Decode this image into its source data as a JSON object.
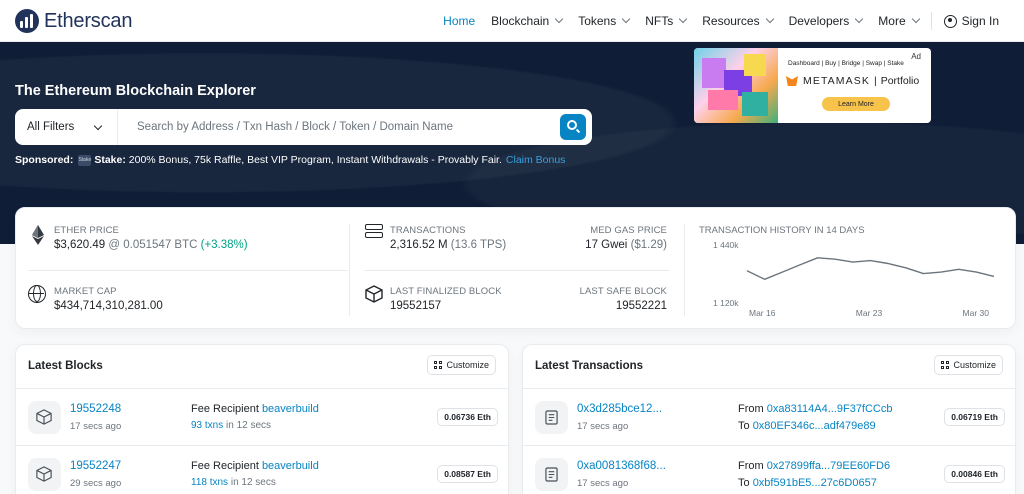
{
  "nav": {
    "brand": "Etherscan",
    "items": [
      {
        "label": "Home",
        "active": true,
        "dropdown": false
      },
      {
        "label": "Blockchain",
        "dropdown": true
      },
      {
        "label": "Tokens",
        "dropdown": true
      },
      {
        "label": "NFTs",
        "dropdown": true
      },
      {
        "label": "Resources",
        "dropdown": true
      },
      {
        "label": "Developers",
        "dropdown": true
      },
      {
        "label": "More",
        "dropdown": true
      }
    ],
    "sign_in": "Sign In"
  },
  "hero": {
    "title": "The Ethereum Blockchain Explorer",
    "filter": "All Filters",
    "search_placeholder": "Search by Address / Txn Hash / Block / Token / Domain Name",
    "sponsored_label": "Sponsored:",
    "sponsor_logo_text": "Stake",
    "sponsor_name": "Stake:",
    "sponsor_text": "200% Bonus, 75k Raffle, Best VIP Program, Instant Withdrawals - Provably Fair.",
    "sponsor_link": "Claim Bonus"
  },
  "ad": {
    "label": "Ad",
    "links": "Dashboard | Buy | Bridge | Swap | Stake",
    "brand": "METAMASK",
    "brand_sep": "|",
    "product": "Portfolio",
    "cta": "Learn More"
  },
  "stats": {
    "ether_price_label": "ETHER PRICE",
    "ether_price": "$3,620.49",
    "ether_btc": "@ 0.051547 BTC",
    "ether_change": "(+3.38%)",
    "market_cap_label": "MARKET CAP",
    "market_cap": "$434,714,310,281.00",
    "transactions_label": "TRANSACTIONS",
    "transactions": "2,316.52 M",
    "tps": "(13.6 TPS)",
    "gas_label": "MED GAS PRICE",
    "gas": "17 Gwei",
    "gas_usd": "($1.29)",
    "finalized_label": "LAST FINALIZED BLOCK",
    "finalized": "19552157",
    "safe_label": "LAST SAFE BLOCK",
    "safe": "19552221",
    "chart_title": "TRANSACTION HISTORY IN 14 DAYS"
  },
  "chart_data": {
    "type": "line",
    "title": "TRANSACTION HISTORY IN 14 DAYS",
    "x_tick_labels": [
      "Mar 16",
      "Mar 23",
      "Mar 30"
    ],
    "y_tick_labels": [
      "1 440k",
      "1 120k"
    ],
    "ylim": [
      1120000,
      1440000
    ],
    "values": [
      1310000,
      1250000,
      1300000,
      1350000,
      1400000,
      1390000,
      1370000,
      1380000,
      1360000,
      1330000,
      1290000,
      1300000,
      1320000,
      1300000,
      1270000
    ]
  },
  "blocks": {
    "title": "Latest Blocks",
    "customize": "Customize",
    "rows": [
      {
        "id": "19552248",
        "time": "17 secs ago",
        "fee_label": "Fee Recipient",
        "recipient": "beaverbuild",
        "txns": "93 txns",
        "txn_time": "in 12 secs",
        "amount": "0.06736 Eth"
      },
      {
        "id": "19552247",
        "time": "29 secs ago",
        "fee_label": "Fee Recipient",
        "recipient": "beaverbuild",
        "txns": "118 txns",
        "txn_time": "in 12 secs",
        "amount": "0.08587 Eth"
      }
    ]
  },
  "transactions": {
    "title": "Latest Transactions",
    "customize": "Customize",
    "rows": [
      {
        "hash": "0x3d285bce12...",
        "time": "17 secs ago",
        "from_label": "From",
        "from": "0xa83114A4...9F37fCCcb",
        "to_label": "To",
        "to": "0x80EF346c...adf479e89",
        "amount": "0.06719 Eth"
      },
      {
        "hash": "0xa0081368f68...",
        "time": "17 secs ago",
        "from_label": "From",
        "from": "0x27899ffa...79EE60FD6",
        "to_label": "To",
        "to": "0xbf591bE5...27c6D0657",
        "amount": "0.00846 Eth"
      }
    ]
  },
  "colors": {
    "primary": "#0784c3",
    "hero_bg": "#0f1e36",
    "positive": "#00a186"
  }
}
